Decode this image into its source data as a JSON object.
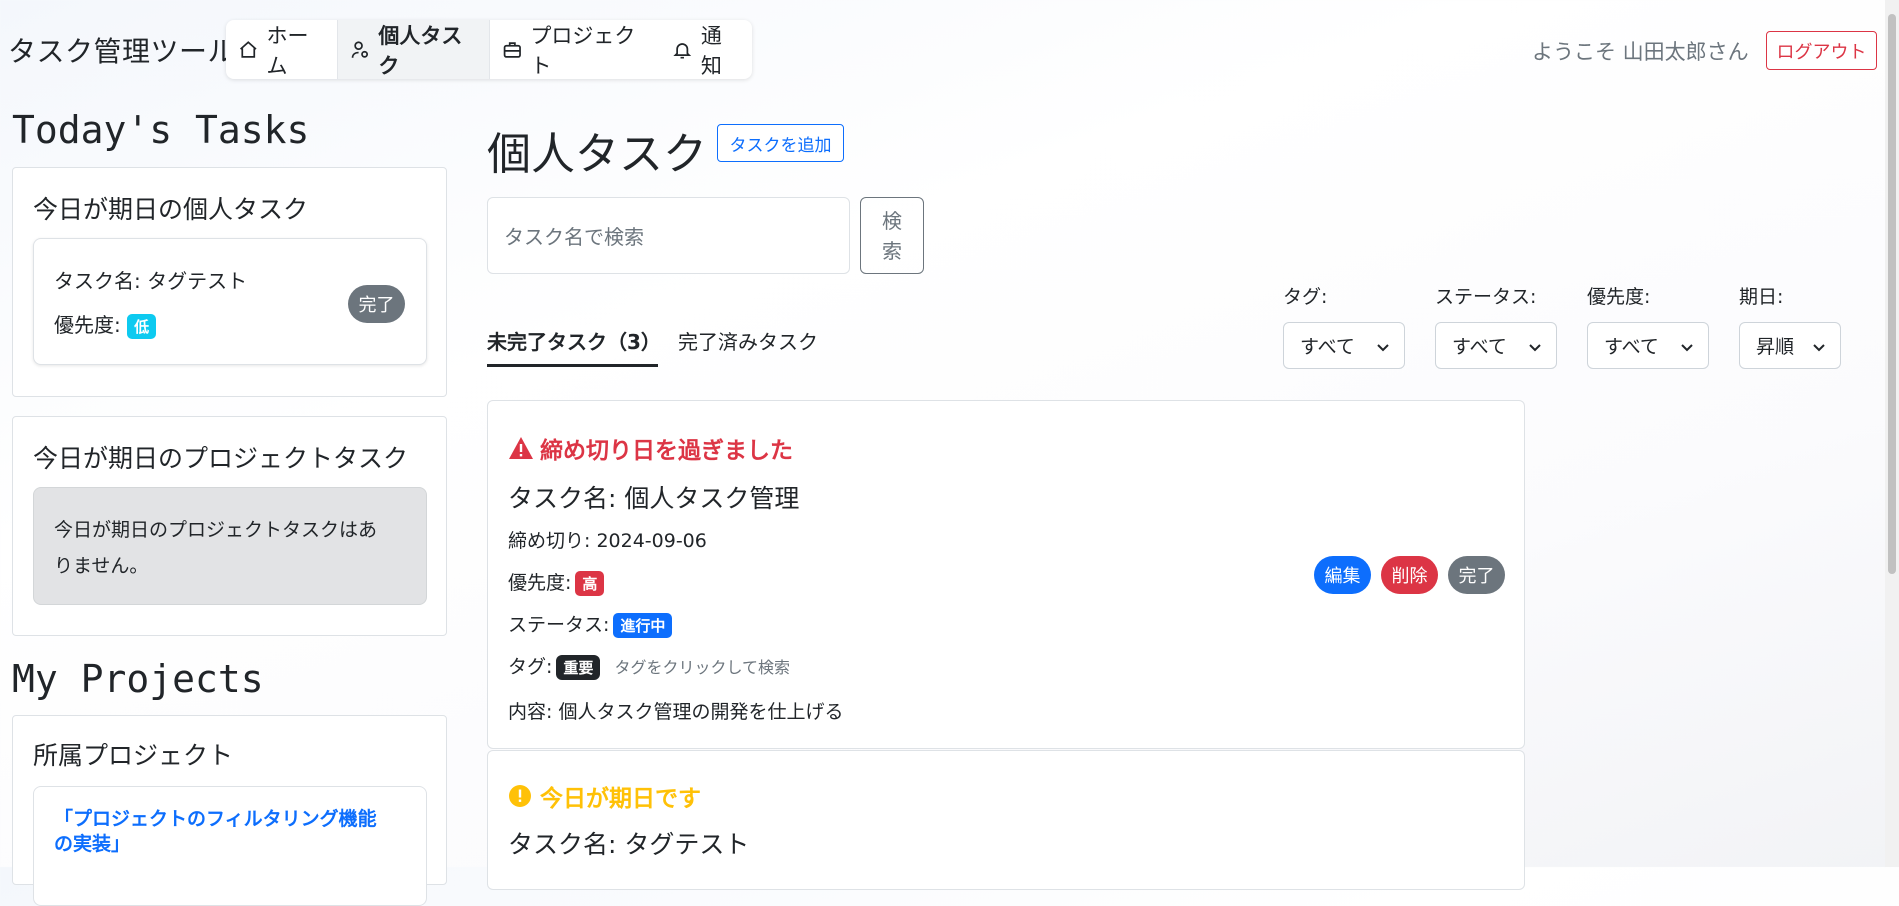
{
  "app": {
    "title": "タスク管理ツール"
  },
  "nav": {
    "home": "ホーム",
    "personal": "個人タスク",
    "project": "プロジェクト",
    "notifications": "通知"
  },
  "header": {
    "welcome": "ようこそ 山田太郎さん",
    "logout": "ログアウト"
  },
  "sidebar": {
    "today_heading": "Today's Tasks",
    "personal_card": {
      "title": "今日が期日の個人タスク",
      "task_name": "タスク名: タグテスト",
      "priority_label": "優先度:",
      "priority": "低",
      "done": "完了"
    },
    "project_card": {
      "title": "今日が期日のプロジェクトタスク",
      "empty_line1": "今日が期日のプロジェクトタスクはあ",
      "empty_line2": "りません。"
    },
    "projects_heading": "My Projects",
    "projects_card": {
      "title": "所属プロジェクト",
      "project_line1": "「プロジェクトのフィルタリング機能",
      "project_line2": "の実装」"
    }
  },
  "main": {
    "title": "個人タスク",
    "add_button": "タスクを追加",
    "search_placeholder": "タスク名で検索",
    "search_button_line1": "検",
    "search_button_line2": "索",
    "tabs": {
      "incomplete": "未完了タスク（3）",
      "completed": "完了済みタスク"
    },
    "filters": {
      "tag": {
        "label": "タグ:",
        "value": "すべて"
      },
      "status": {
        "label": "ステータス:",
        "value": "すべて"
      },
      "priority": {
        "label": "優先度:",
        "value": "すべて"
      },
      "due": {
        "label": "期日:",
        "value": "昇順"
      }
    },
    "tasks": [
      {
        "alert": "締め切り日を過ぎました",
        "alert_color": "#dc3545",
        "name": "タスク名: 個人タスク管理",
        "deadline": "締め切り: 2024-09-06",
        "priority_label": "優先度:",
        "priority": "高",
        "status_label": "ステータス:",
        "status": "進行中",
        "tag_label": "タグ:",
        "tag": "重要",
        "tag_hint": "タグをクリックして検索",
        "content": "内容:  個人タスク管理の開発を仕上げる",
        "edit": "編集",
        "delete": "削除",
        "complete": "完了"
      },
      {
        "alert": "今日が期日です",
        "alert_color": "#ffc107",
        "name": "タスク名: タグテスト"
      }
    ]
  },
  "colors": {
    "primary": "#0d6efd",
    "danger": "#dc3545",
    "warning": "#ffc107",
    "info": "#0dcaf0",
    "secondary": "#6c757d",
    "dark": "#212529"
  }
}
